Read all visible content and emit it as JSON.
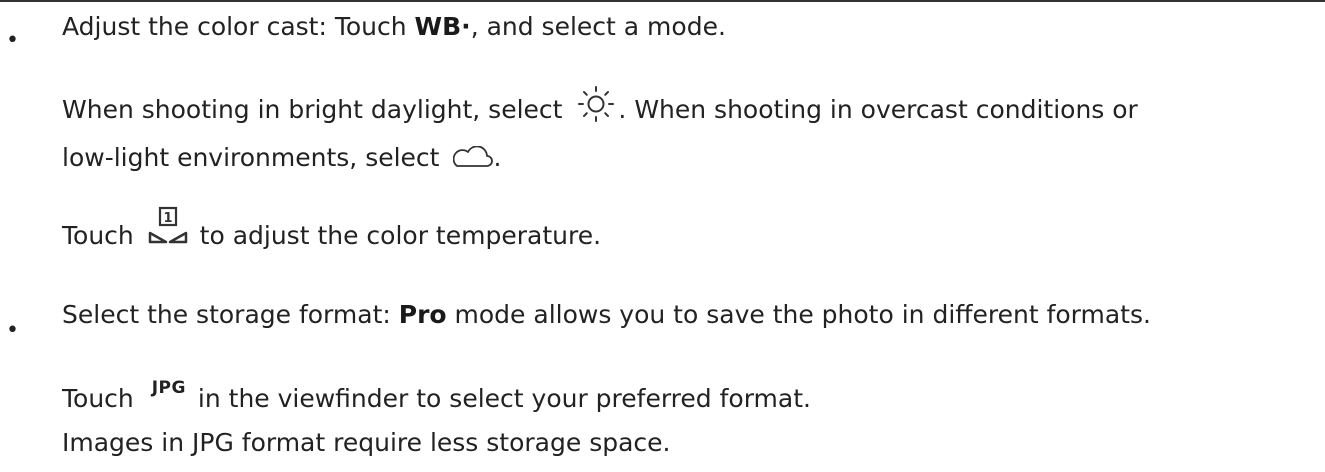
{
  "bullets": [
    "•",
    "•"
  ],
  "item1": {
    "prefix": "Adjust the color cast: Touch ",
    "wb": "WB·",
    "suffix": ", and select a mode."
  },
  "para1": {
    "part1": "When shooting in bright daylight, select ",
    "part2": ". When shooting in overcast conditions or"
  },
  "para2": {
    "part1": "low-light environments, select ",
    "part2": "."
  },
  "para3": {
    "touch": "Touch ",
    "rest": " to adjust the color temperature.",
    "icon_number": "1"
  },
  "item2": {
    "prefix": "Select the storage format: ",
    "pro": "Pro",
    "suffix": " mode allows you to save the photo in different formats."
  },
  "para4": {
    "touch": "Touch ",
    "jpg": "JPG",
    "rest": " in the viewfinder to select your preferred format."
  },
  "para5": "Images in JPG format require less storage space.",
  "icons": [
    "sun-icon",
    "cloud-icon",
    "color-temperature-icon",
    "jpg-format-icon"
  ],
  "colors": {
    "text": "#222222",
    "rule": "#333333"
  }
}
